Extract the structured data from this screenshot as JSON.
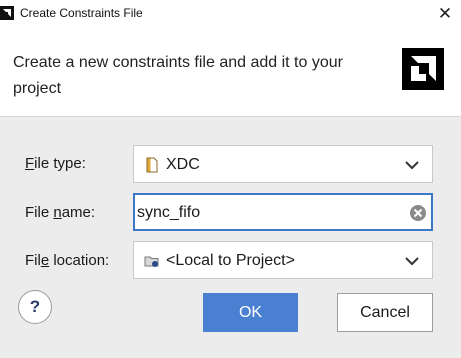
{
  "window": {
    "title": "Create Constraints File",
    "close_glyph": "✕",
    "app_icon": "vivado-logo-icon"
  },
  "header": {
    "description": "Create a new constraints file and add it to your project",
    "logo": "amd-logo-icon"
  },
  "form": {
    "file_type": {
      "label_mnemonic": "F",
      "label_rest": "ile type:",
      "value": "XDC",
      "icon": "file-icon"
    },
    "file_name": {
      "label_pre": "File ",
      "label_mnemonic": "n",
      "label_rest": "ame:",
      "value": "sync_fifo"
    },
    "file_location": {
      "label_pre": "Fil",
      "label_mnemonic": "e",
      "label_rest": " location:",
      "value": "<Local to Project>",
      "icon": "folder-icon"
    }
  },
  "buttons": {
    "help": "?",
    "ok": "OK",
    "cancel": "Cancel"
  },
  "colors": {
    "accent": "#4a80d2",
    "focus_border": "#3c78c8",
    "background": "#ececec"
  }
}
